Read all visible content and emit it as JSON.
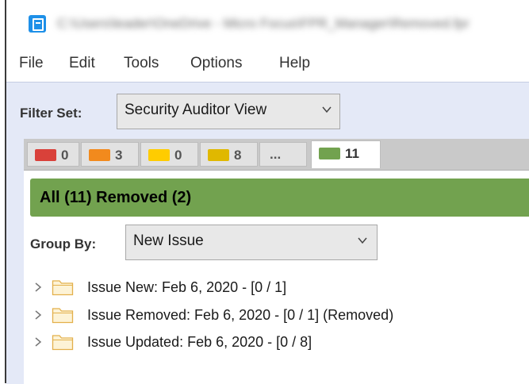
{
  "window": {
    "title": "C:\\Users\\leader\\OneDrive - Micro Focus\\FPR_Manager\\Removed.fpr"
  },
  "menu": {
    "items": [
      {
        "label": "File"
      },
      {
        "label": "Edit"
      },
      {
        "label": "Tools"
      },
      {
        "label": "Options"
      },
      {
        "label": "Help"
      }
    ]
  },
  "filter_set": {
    "label": "Filter Set:",
    "value": "Security Auditor View"
  },
  "tabs": [
    {
      "count": "0",
      "color": "#d9413a"
    },
    {
      "count": "3",
      "color": "#f28a1d"
    },
    {
      "count": "0",
      "color": "#ffcc00"
    },
    {
      "count": "8",
      "color": "#e0b800"
    },
    {
      "count": "..."
    },
    {
      "count": "11",
      "color": "#72a24f",
      "active": true
    }
  ],
  "summary": {
    "text": "All (11) Removed (2)",
    "color": "#72a24f"
  },
  "group_by": {
    "label": "Group By:",
    "value": "New Issue"
  },
  "tree": [
    {
      "label": "Issue New: Feb 6, 2020 - [0 / 1]"
    },
    {
      "label": "Issue Removed: Feb 6, 2020 - [0 / 1] (Removed)"
    },
    {
      "label": "Issue Updated: Feb 6, 2020 - [0 / 8]"
    }
  ]
}
